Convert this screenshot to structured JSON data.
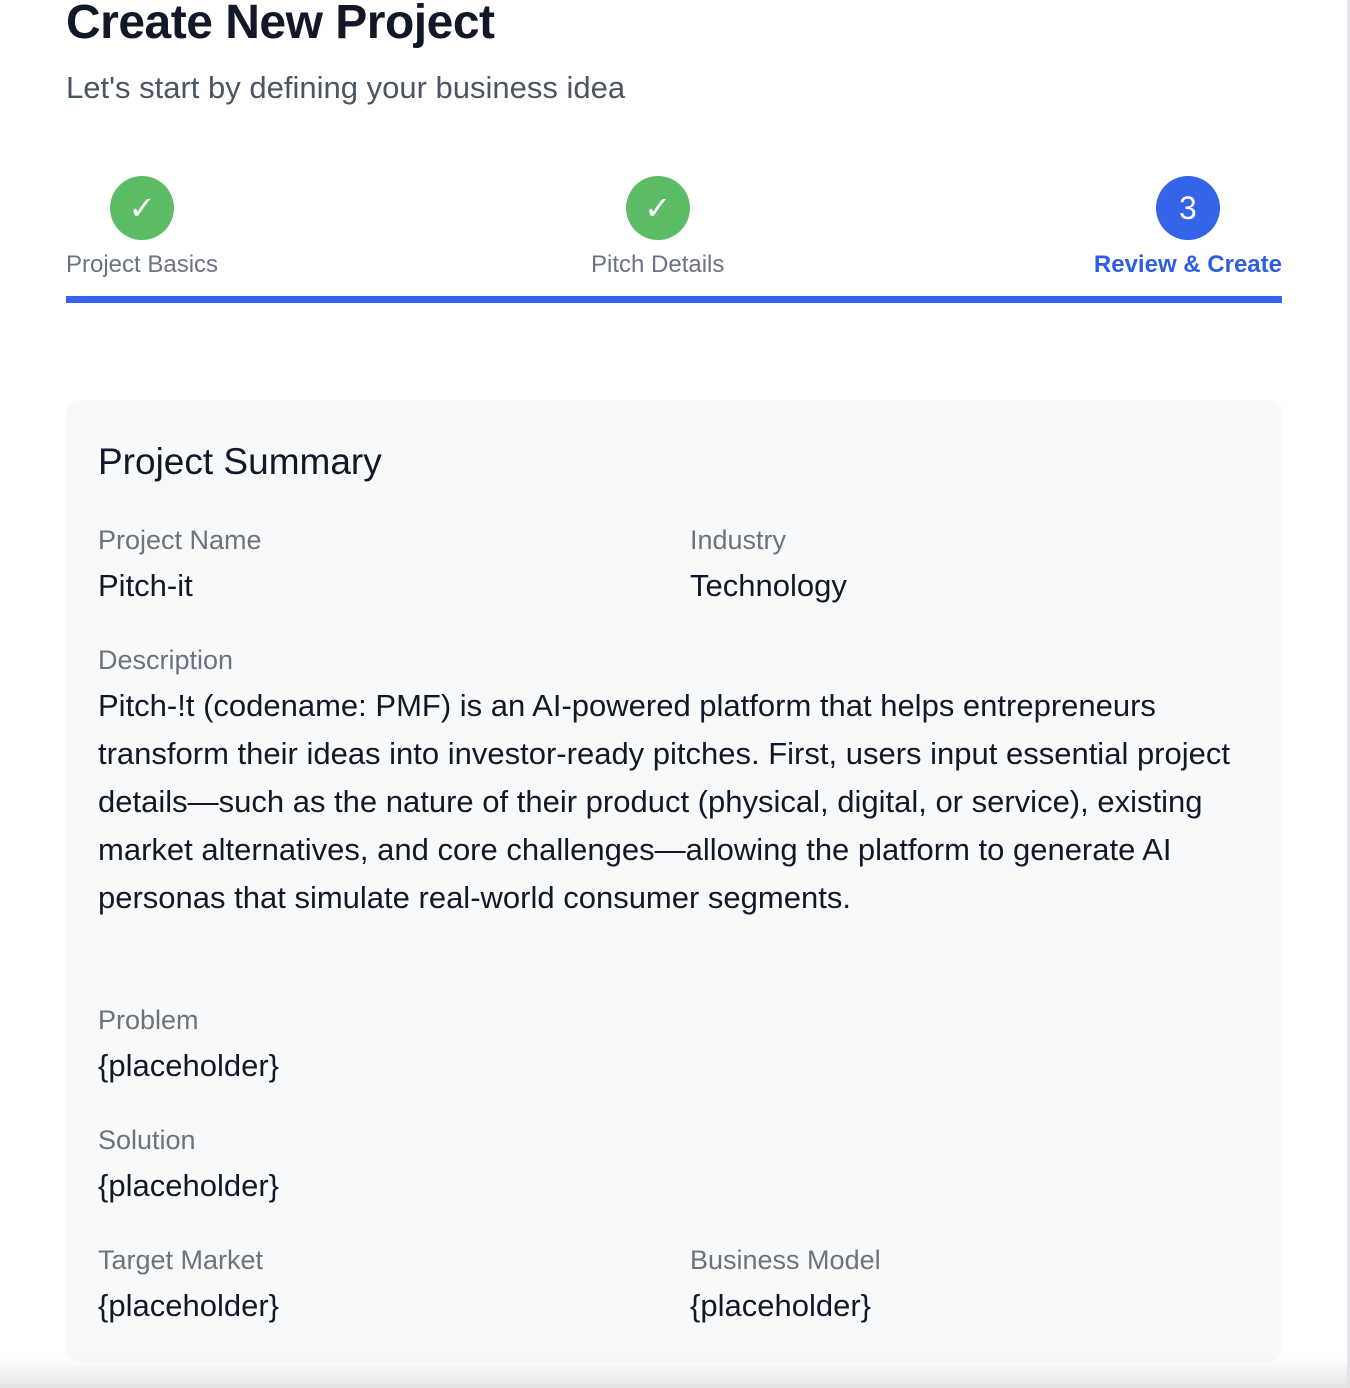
{
  "header": {
    "title": "Create New Project",
    "subtitle": "Let's start by defining your business idea"
  },
  "stepper": {
    "progress_percent": 100,
    "steps": [
      {
        "label": "Project Basics",
        "status": "completed",
        "marker": "✓"
      },
      {
        "label": "Pitch Details",
        "status": "completed",
        "marker": "✓"
      },
      {
        "label": "Review & Create",
        "status": "active",
        "marker": "3"
      }
    ]
  },
  "summary": {
    "title": "Project Summary",
    "project_name": {
      "label": "Project Name",
      "value": "Pitch-it"
    },
    "industry": {
      "label": "Industry",
      "value": "Technology"
    },
    "description": {
      "label": "Description",
      "value": "Pitch-!t (codename: PMF) is an AI-powered platform that helps entrepreneurs transform their ideas into investor-ready pitches. First, users input essential project details—such as the nature of their product (physical, digital, or service), existing market alternatives, and core challenges—allowing the platform to generate AI personas that simulate real-world consumer segments."
    },
    "problem": {
      "label": "Problem",
      "value": "{placeholder}"
    },
    "solution": {
      "label": "Solution",
      "value": "{placeholder}"
    },
    "target_market": {
      "label": "Target Market",
      "value": "{placeholder}"
    },
    "business_model": {
      "label": "Business Model",
      "value": "{placeholder}"
    }
  },
  "colors": {
    "accent": "#3563e9",
    "success": "#5cbd66",
    "card_background": "#f8f9fb"
  }
}
